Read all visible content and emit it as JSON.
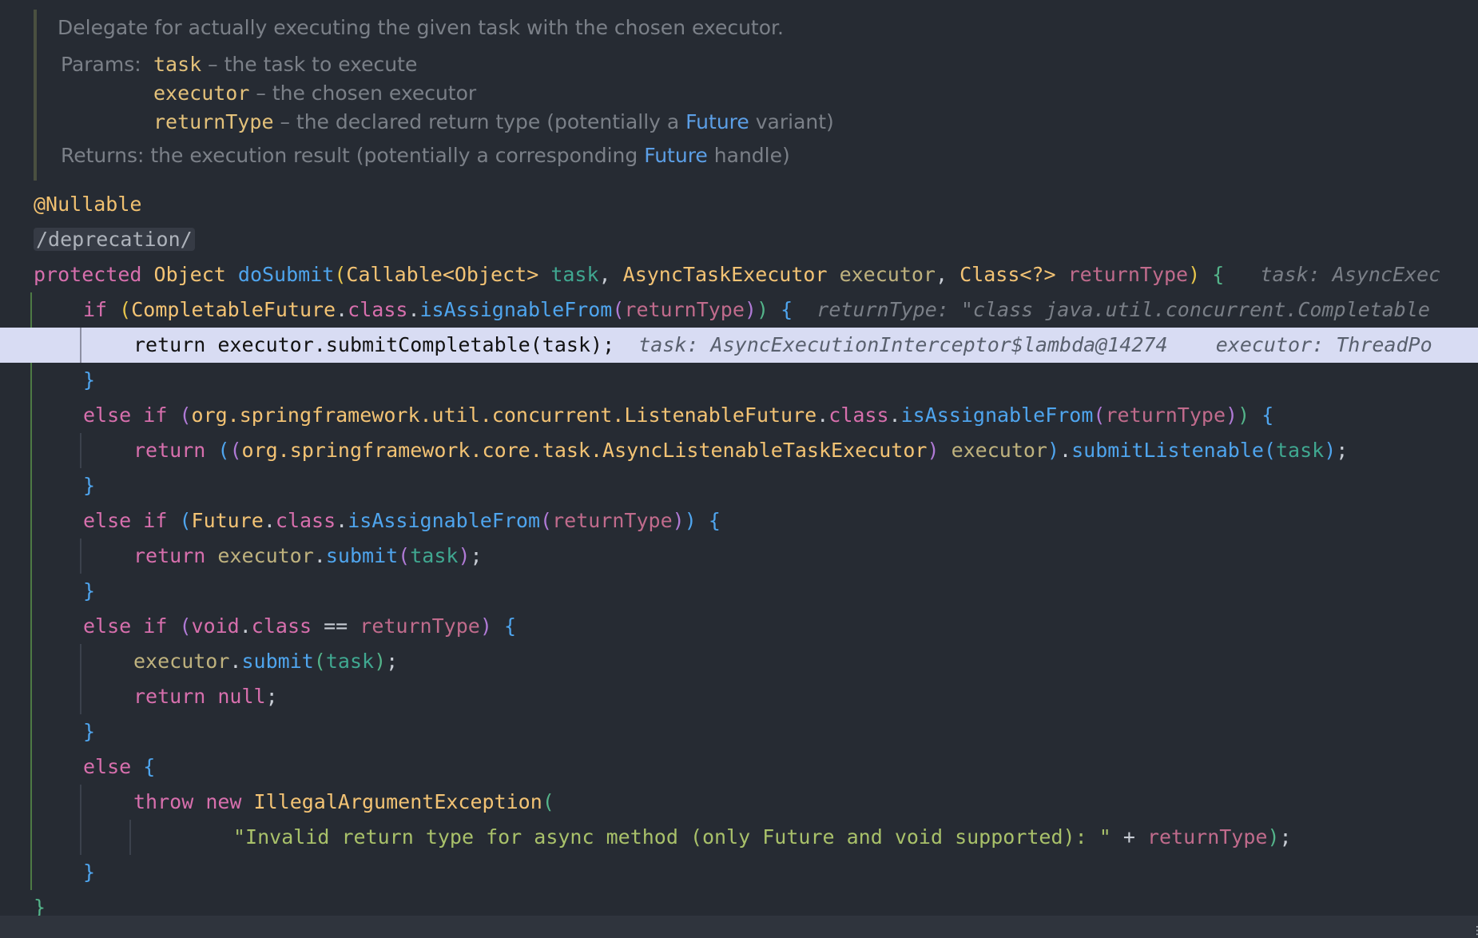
{
  "doc": {
    "summary": "Delegate for actually executing the given task with the chosen executor.",
    "params_label": "Params:",
    "params": [
      {
        "name": "task",
        "desc_prefix": " – the task to execute",
        "link": "",
        "desc_suffix": ""
      },
      {
        "name": "executor",
        "desc_prefix": " – the chosen executor",
        "link": "",
        "desc_suffix": ""
      },
      {
        "name": "returnType",
        "desc_prefix": " – the declared return type (potentially a ",
        "link": "Future",
        "desc_suffix": " variant)"
      }
    ],
    "returns_label": "Returns:",
    "returns_prefix": " the execution result (potentially a corresponding ",
    "returns_link": "Future",
    "returns_suffix": " handle)"
  },
  "tokens": {
    "k_protected": "protected",
    "k_if": "if",
    "k_else": "else",
    "k_return": "return",
    "k_class": "class",
    "k_void": "void",
    "k_null": "null",
    "k_throw": "throw",
    "k_new": "new",
    "t_Object": "Object",
    "t_Callable": "Callable",
    "t_AsyncTaskExecutor": "AsyncTaskExecutor",
    "t_Class": "Class",
    "t_CompletableFuture": "CompletableFuture",
    "t_pkg_util": "org.springframework.util.concurrent.",
    "t_ListenableFuture": "ListenableFuture",
    "t_pkg_core": "org.springframework.core.task.",
    "t_AsyncListenableTaskExecutor": "AsyncListenableTaskExecutor",
    "t_Future": "Future",
    "t_IllegalArgumentException": "IllegalArgumentException",
    "f_doSubmit": "doSubmit",
    "f_isAssignableFrom": "isAssignableFrom",
    "f_submitCompletable": "submitCompletable",
    "f_submitListenable": "submitListenable",
    "f_submit": "submit",
    "p_task": "task",
    "p_executor": "executor",
    "p_returnType": "returnType",
    "str_invalid": "\"Invalid return type for async method (only Future and void supported): \""
  },
  "code": {
    "annotation": "@Nullable",
    "folded": "/deprecation/"
  },
  "hints": {
    "line_signature": "task: AsyncExec",
    "line_if": "returnType: \"class java.util.concurrent.Completable",
    "line_return_task": "task: AsyncExecutionInterceptor$lambda@14274",
    "line_return_executor": "executor: ThreadPo"
  }
}
